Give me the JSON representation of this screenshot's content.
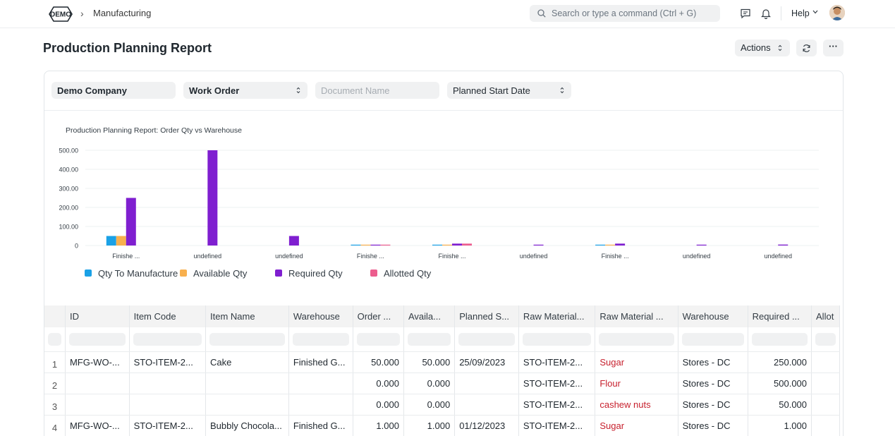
{
  "navbar": {
    "logo_text": "DEMO",
    "breadcrumb": "Manufacturing",
    "search_placeholder": "Search or type a command (Ctrl + G)",
    "help_label": "Help"
  },
  "page": {
    "title": "Production Planning Report",
    "actions_label": "Actions",
    "more_label": "···"
  },
  "filters": {
    "company": "Demo Company",
    "based_on": "Work Order",
    "document_name_placeholder": "Document Name",
    "order_by": "Planned Start Date"
  },
  "chart_data": {
    "type": "bar",
    "title": "Production Planning Report: Order Qty vs Warehouse",
    "categories": [
      "Finishe ...",
      "undefined",
      "undefined",
      "Finishe ...",
      "Finishe ...",
      "undefined",
      "Finishe ...",
      "undefined",
      "undefined"
    ],
    "series": [
      {
        "name": "Qty To Manufacture",
        "color": "#1aa1e6",
        "values": [
          50,
          0,
          0,
          1,
          1,
          0,
          1,
          0,
          0
        ]
      },
      {
        "name": "Available Qty",
        "color": "#f8b04e",
        "values": [
          50,
          0,
          0,
          1,
          1,
          0,
          1,
          0,
          0
        ]
      },
      {
        "name": "Required Qty",
        "color": "#7f1fd0",
        "values": [
          250,
          500,
          50,
          1,
          10,
          1,
          10,
          1,
          5
        ]
      },
      {
        "name": "Allotted Qty",
        "color": "#ec5d8e",
        "values": [
          0,
          0,
          0,
          1,
          10,
          0,
          0,
          0,
          0
        ]
      }
    ],
    "y_ticks": [
      "0",
      "100.00",
      "200.00",
      "300.00",
      "400.00",
      "500.00"
    ],
    "ylim": [
      0,
      500
    ],
    "grid": true,
    "legend": "bottom-left"
  },
  "table": {
    "columns": [
      "ID",
      "Item Code",
      "Item Name",
      "Warehouse",
      "Order ...",
      "Availa...",
      "Planned S...",
      "Raw Material...",
      "Raw Material ...",
      "Warehouse",
      "Required ...",
      "Allot"
    ],
    "rows": [
      [
        "1",
        "MFG-WO-...",
        "STO-ITEM-2...",
        "Cake",
        "Finished G...",
        "50.000",
        "50.000",
        "25/09/2023",
        "STO-ITEM-2...",
        "Sugar",
        "Stores - DC",
        "250.000",
        ""
      ],
      [
        "2",
        "",
        "",
        "",
        "",
        "0.000",
        "0.000",
        "",
        "STO-ITEM-2...",
        "Flour",
        "Stores - DC",
        "500.000",
        ""
      ],
      [
        "3",
        "",
        "",
        "",
        "",
        "0.000",
        "0.000",
        "",
        "STO-ITEM-2...",
        "cashew nuts",
        "Stores - DC",
        "50.000",
        ""
      ],
      [
        "4",
        "MFG-WO-...",
        "STO-ITEM-2...",
        "Bubbly Chocola...",
        "Finished G...",
        "1.000",
        "1.000",
        "01/12/2023",
        "STO-ITEM-2...",
        "Sugar",
        "Stores - DC",
        "1.000",
        ""
      ]
    ]
  }
}
